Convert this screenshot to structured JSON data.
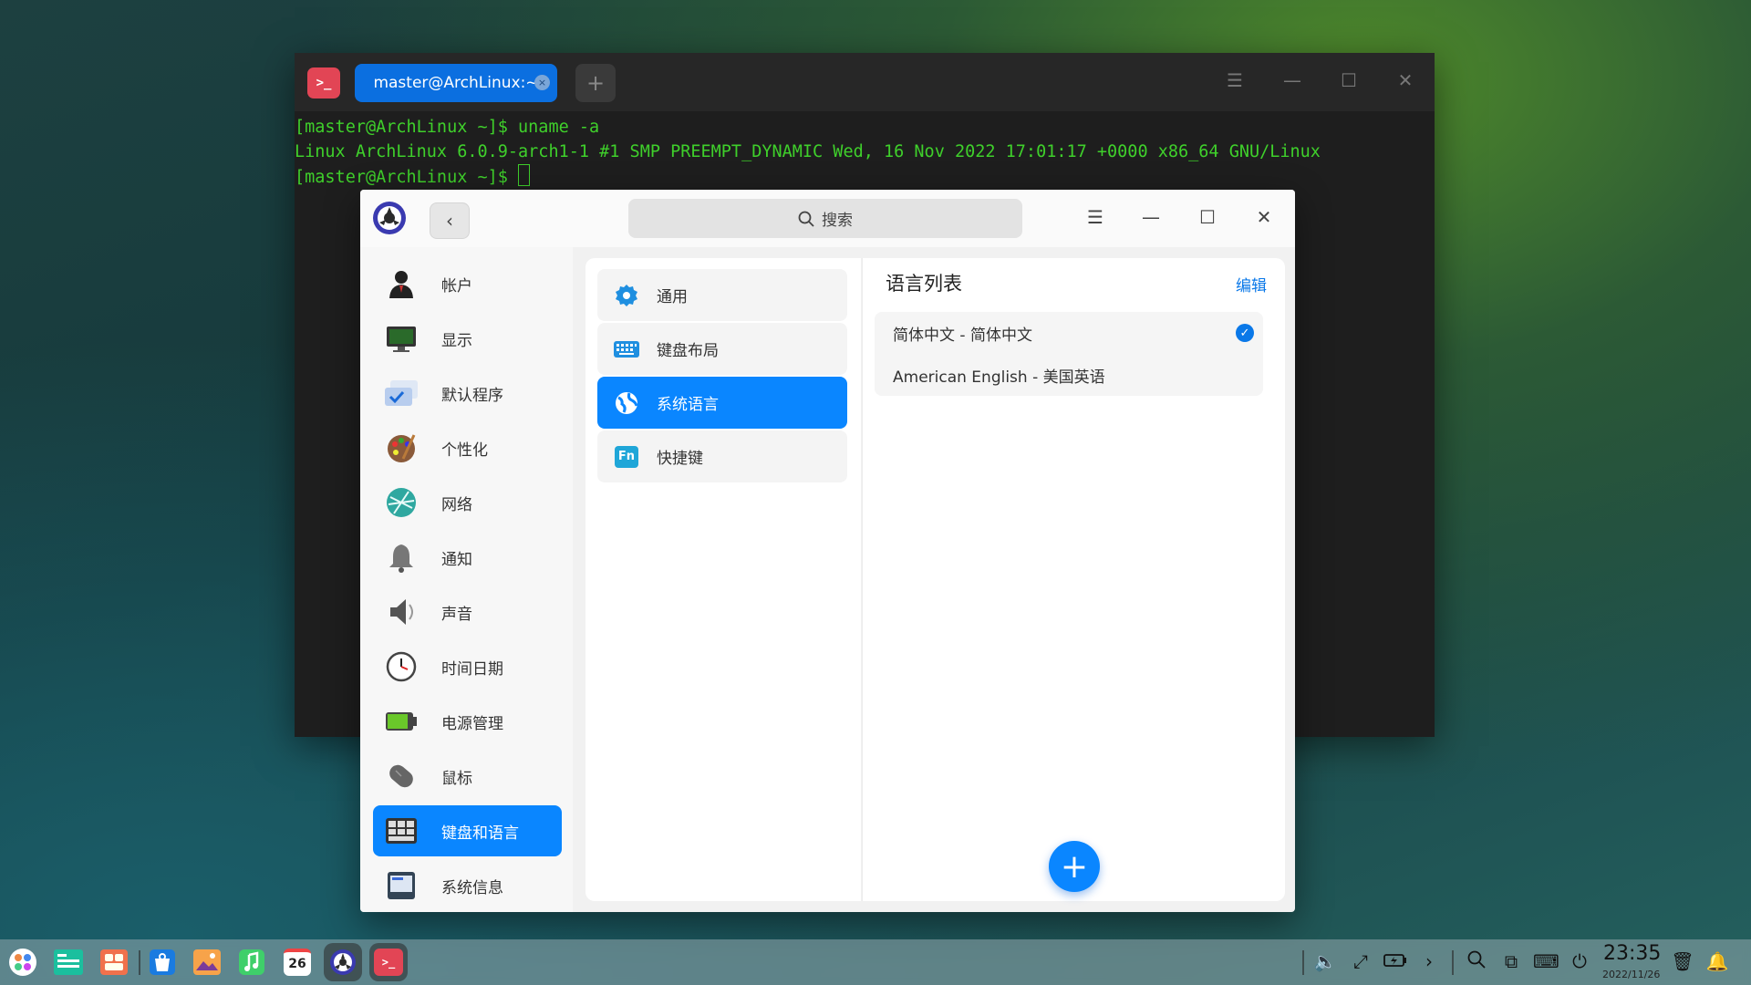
{
  "terminal": {
    "tab_title": "master@ArchLinux:~",
    "tab_close": "×",
    "new_tab": "+",
    "line1": "[master@ArchLinux ~]$ uname -a",
    "line2": "Linux ArchLinux 6.0.9-arch1-1 #1 SMP PREEMPT_DYNAMIC Wed, 16 Nov 2022 17:01:17 +0000 x86_64 GNU/Linux",
    "line3": "[master@ArchLinux ~]$ ",
    "logo_glyph": ">_"
  },
  "settings": {
    "search_placeholder": "搜索",
    "nav": [
      {
        "label": "帐户",
        "icon": "account-icon"
      },
      {
        "label": "显示",
        "icon": "display-icon"
      },
      {
        "label": "默认程序",
        "icon": "default-apps-icon"
      },
      {
        "label": "个性化",
        "icon": "personalization-icon"
      },
      {
        "label": "网络",
        "icon": "network-icon"
      },
      {
        "label": "通知",
        "icon": "notification-bell-icon"
      },
      {
        "label": "声音",
        "icon": "sound-icon"
      },
      {
        "label": "时间日期",
        "icon": "clock-icon"
      },
      {
        "label": "电源管理",
        "icon": "battery-icon"
      },
      {
        "label": "鼠标",
        "icon": "mouse-icon"
      },
      {
        "label": "键盘和语言",
        "icon": "keyboard-language-icon",
        "active": true
      },
      {
        "label": "系统信息",
        "icon": "system-info-icon"
      }
    ],
    "sub_nav": [
      {
        "label": "通用",
        "icon": "gear-icon"
      },
      {
        "label": "键盘布局",
        "icon": "keyboard-icon"
      },
      {
        "label": "系统语言",
        "icon": "globe-icon",
        "active": true
      },
      {
        "label": "快捷键",
        "icon": "fn-key-icon",
        "icon_text": "Fn"
      }
    ],
    "language_panel": {
      "title": "语言列表",
      "edit_label": "编辑",
      "languages": [
        {
          "label": "简体中文 - 简体中文",
          "selected": true
        },
        {
          "label": "American English - 美国英语",
          "selected": false
        }
      ],
      "add_label": "+"
    }
  },
  "dock": {
    "calendar_day": "26",
    "clock_time": "23:35",
    "clock_date": "2022/11/26",
    "terminal_glyph": ">_"
  },
  "colors": {
    "accent": "#0a86ff",
    "terminal_green": "#3fd02b",
    "terminal_red": "#e24555"
  }
}
